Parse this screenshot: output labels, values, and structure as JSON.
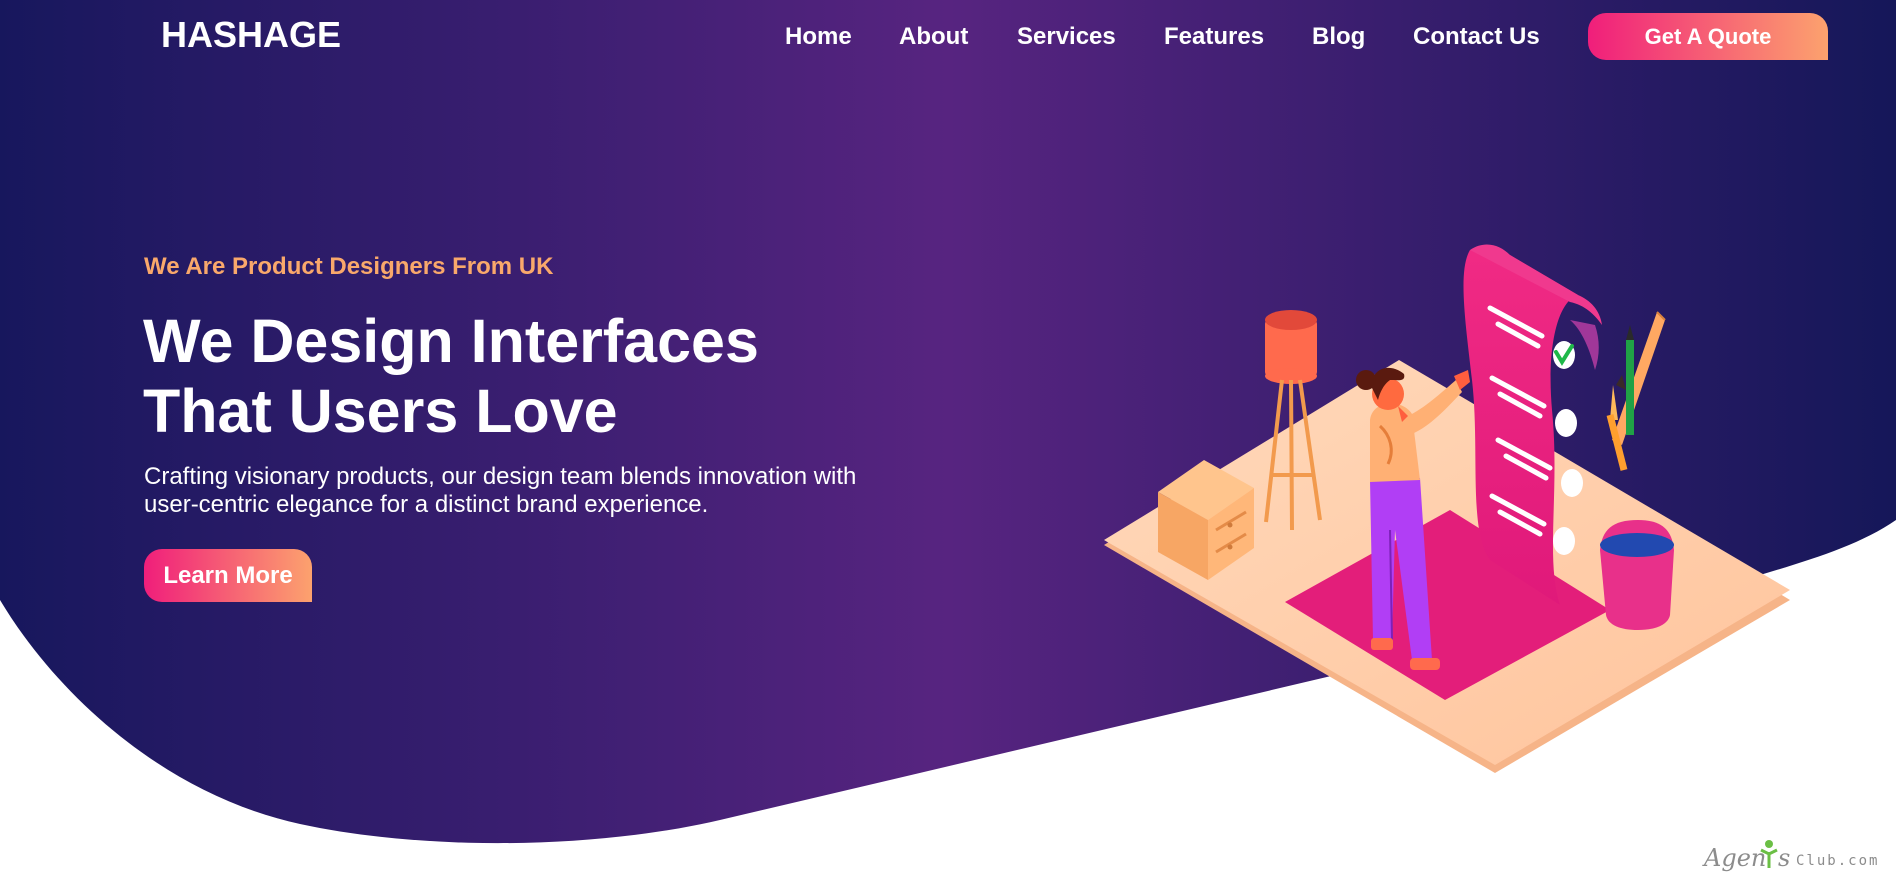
{
  "colors": {
    "hero_dark": "#17175d",
    "hero_purple": "#572480",
    "accent_pink": "#f01e7b",
    "accent_orange": "#fca26e",
    "text_white": "#ffffff",
    "tagline_orange": "#f9a86b"
  },
  "header": {
    "logo": "HASHAGE",
    "nav": [
      {
        "label": "Home"
      },
      {
        "label": "About"
      },
      {
        "label": "Services"
      },
      {
        "label": "Features"
      },
      {
        "label": "Blog"
      },
      {
        "label": "Contact Us"
      }
    ],
    "cta_label": "Get A Quote"
  },
  "hero": {
    "tagline": "We Are Product Designers From UK",
    "headline_line1": "We Design Interfaces",
    "headline_line2": "That Users Love",
    "description_line1": "Crafting visionary products, our design team blends innovation with",
    "description_line2": "user-centric elegance for a distinct brand experience.",
    "button_label": "Learn More"
  },
  "illustration": {
    "icon": "checklist-designer-illustration"
  },
  "watermark": {
    "brand": "Agen",
    "brand_tail": "s",
    "suffix": "Club.com"
  }
}
